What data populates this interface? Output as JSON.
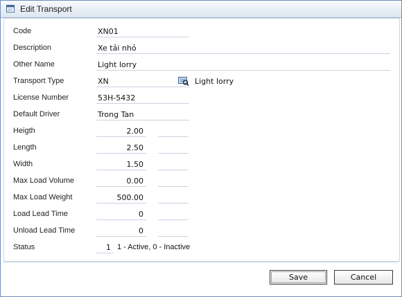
{
  "window": {
    "title": "Edit Transport"
  },
  "form": {
    "code": {
      "label": "Code",
      "value": "XN01"
    },
    "description": {
      "label": "Description",
      "value": "Xe tải nhỏ"
    },
    "other_name": {
      "label": "Other Name",
      "value": "Light lorry"
    },
    "transport_type": {
      "label": "Transport Type",
      "value": "XN",
      "lookup_text": "Light lorry",
      "icon": "lookup-icon"
    },
    "license_number": {
      "label": "License Number",
      "value": "53H-5432"
    },
    "default_driver": {
      "label": "Default Driver",
      "value": "Trong Tan"
    },
    "height": {
      "label": "Heigth",
      "value": "2.00"
    },
    "length": {
      "label": "Length",
      "value": "2.50"
    },
    "width": {
      "label": "Width",
      "value": "1.50"
    },
    "max_load_volume": {
      "label": "Max Load Volume",
      "value": "0.00"
    },
    "max_load_weight": {
      "label": "Max Load Weight",
      "value": "500.00"
    },
    "load_lead_time": {
      "label": "Load Lead Time",
      "value": "0"
    },
    "unload_lead_time": {
      "label": "Unload Lead Time",
      "value": "0"
    },
    "status": {
      "label": "Status",
      "value": "1",
      "hint": "1 - Active, 0 - Inactive"
    }
  },
  "buttons": {
    "save": "Save",
    "cancel": "Cancel"
  }
}
